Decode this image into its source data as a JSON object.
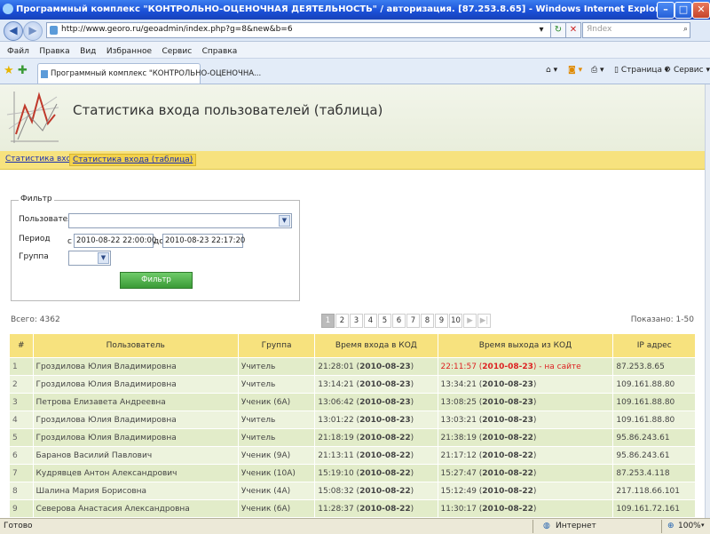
{
  "window": {
    "title": "Программный комплекс \"КОНТРОЛЬНО-ОЦЕНОЧНАЯ ДЕЯТЕЛЬНОСТЬ\" / авторизация. [87.253.8.65] - Windows Internet Explorer",
    "url": "http://www.georo.ru/geoadmin/index.php?g=8&new&b=6",
    "search_placeholder": "Яndex",
    "menu": [
      "Файл",
      "Правка",
      "Вид",
      "Избранное",
      "Сервис",
      "Справка"
    ],
    "tab_title": "Программный комплекс \"КОНТРОЛЬНО-ОЦЕНОЧНА...",
    "toolbar": {
      "page": "Страница",
      "service": "Сервис"
    },
    "status_left": "Готово",
    "status_zone": "Интернет",
    "zoom": "100%"
  },
  "page": {
    "title": "Статистика входа пользователей (таблица)",
    "nav": [
      "Статистика входа",
      "Статистика входа (таблица)"
    ]
  },
  "filter": {
    "legend": "Фильтр",
    "user_label": "Пользователь",
    "user_value": "",
    "period_label": "Период",
    "from_label": "с",
    "from_value": "2010-08-22 22:00:00",
    "to_label": "до",
    "to_value": "2010-08-23 22:17:20",
    "group_label": "Группа",
    "group_value": "",
    "button": "Фильтр"
  },
  "pager": {
    "total": "Всего: 4362",
    "shown": "Показано: 1-50",
    "pages": [
      "1",
      "2",
      "3",
      "4",
      "5",
      "6",
      "7",
      "8",
      "9",
      "10"
    ],
    "current": "1"
  },
  "table": {
    "columns": [
      "#",
      "Пользователь",
      "Группа",
      "Время входа в КОД",
      "Время выхода из КОД",
      "IP адрес"
    ],
    "rows": [
      {
        "n": "1",
        "user": "Гроздилова Юлия Владимировна",
        "group": "Учитель",
        "in_time": "21:28:01",
        "in_date": "2010-08-23",
        "out_time": "22:11:57",
        "out_date": "2010-08-23",
        "out_note": " - на сайте",
        "ip": "87.253.8.65"
      },
      {
        "n": "2",
        "user": "Гроздилова Юлия Владимировна",
        "group": "Учитель",
        "in_time": "13:14:21",
        "in_date": "2010-08-23",
        "out_time": "13:34:21",
        "out_date": "2010-08-23",
        "out_note": "",
        "ip": "109.161.88.80"
      },
      {
        "n": "3",
        "user": "Петрова Елизавета Андреевна",
        "group": "Ученик (6А)",
        "in_time": "13:06:42",
        "in_date": "2010-08-23",
        "out_time": "13:08:25",
        "out_date": "2010-08-23",
        "out_note": "",
        "ip": "109.161.88.80"
      },
      {
        "n": "4",
        "user": "Гроздилова Юлия Владимировна",
        "group": "Учитель",
        "in_time": "13:01:22",
        "in_date": "2010-08-23",
        "out_time": "13:03:21",
        "out_date": "2010-08-23",
        "out_note": "",
        "ip": "109.161.88.80"
      },
      {
        "n": "5",
        "user": "Гроздилова Юлия Владимировна",
        "group": "Учитель",
        "in_time": "21:18:19",
        "in_date": "2010-08-22",
        "out_time": "21:38:19",
        "out_date": "2010-08-22",
        "out_note": "",
        "ip": "95.86.243.61"
      },
      {
        "n": "6",
        "user": "Баранов Василий Павлович",
        "group": "Ученик (9А)",
        "in_time": "21:13:11",
        "in_date": "2010-08-22",
        "out_time": "21:17:12",
        "out_date": "2010-08-22",
        "out_note": "",
        "ip": "95.86.243.61"
      },
      {
        "n": "7",
        "user": "Кудрявцев Антон Александрович",
        "group": "Ученик (10А)",
        "in_time": "15:19:10",
        "in_date": "2010-08-22",
        "out_time": "15:27:47",
        "out_date": "2010-08-22",
        "out_note": "",
        "ip": "87.253.4.118"
      },
      {
        "n": "8",
        "user": "Шалина Мария Борисовна",
        "group": "Ученик (4А)",
        "in_time": "15:08:32",
        "in_date": "2010-08-22",
        "out_time": "15:12:49",
        "out_date": "2010-08-22",
        "out_note": "",
        "ip": "217.118.66.101"
      },
      {
        "n": "9",
        "user": "Северова Анастасия Александровна",
        "group": "Ученик (6А)",
        "in_time": "11:28:37",
        "in_date": "2010-08-22",
        "out_time": "11:30:17",
        "out_date": "2010-08-22",
        "out_note": "",
        "ip": "109.161.72.161"
      }
    ]
  },
  "colors": {
    "title_bar": "#1a4fd6",
    "nav_strip": "#f7e27e",
    "row_odd": "#e2ecc9",
    "row_even": "#edf3dd",
    "online_red": "#dd2222"
  }
}
